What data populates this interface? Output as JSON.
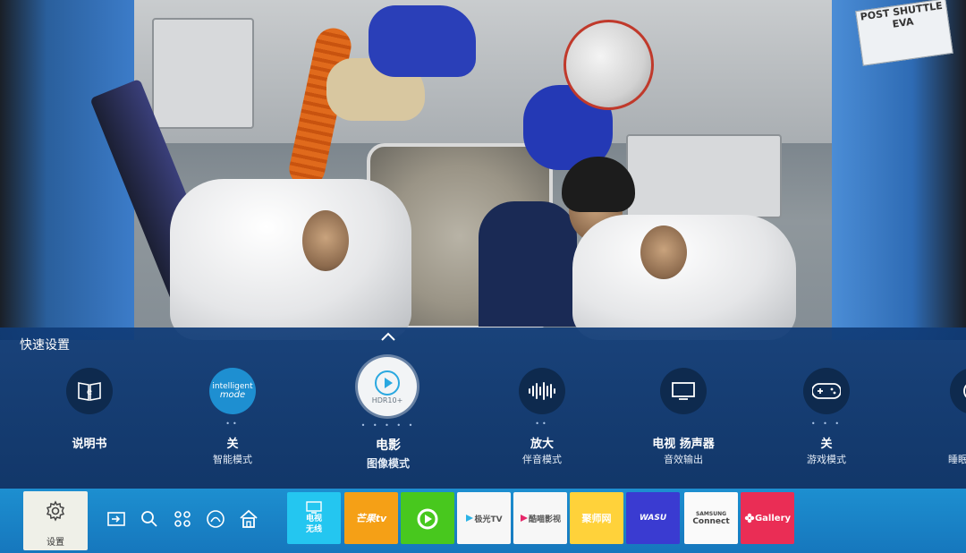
{
  "scene": {
    "sign_line1": "POST SHUTTLE",
    "sign_line2": "EVA"
  },
  "quick_settings": {
    "title": "快速设置",
    "items": [
      {
        "label": "说明书",
        "sub": "",
        "icon": "e-manual-book-icon"
      },
      {
        "label": "关",
        "sub": "智能模式",
        "icon": "intelligent-mode-icon",
        "icon_text1": "intelligent",
        "icon_text2": "mode"
      },
      {
        "label": "电影",
        "sub": "图像模式",
        "icon": "play-hdr10-icon",
        "icon_text": "HDR10+"
      },
      {
        "label": "放大",
        "sub": "伴音模式",
        "icon": "sound-wave-icon"
      },
      {
        "label": "电视 扬声器",
        "sub": "音效输出",
        "icon": "tv-speaker-icon"
      },
      {
        "label": "关",
        "sub": "游戏模式",
        "icon": "gamepad-icon"
      },
      {
        "label": "",
        "sub": "睡眠",
        "icon": "sleep-timer-icon"
      }
    ]
  },
  "bottom_bar": {
    "settings_label": "设置",
    "nav_icons": [
      "source-input-icon",
      "search-icon",
      "apps-grid-icon",
      "ambient-icon",
      "home-icon"
    ],
    "apps": [
      {
        "name": "tv",
        "line1": "电视",
        "line2": "无线"
      },
      {
        "name": "mango-tv",
        "text": "芒果tv"
      },
      {
        "name": "iqiyi-green",
        "text": ""
      },
      {
        "name": "jiguang-tv",
        "text": "极光TV"
      },
      {
        "name": "kuku-video",
        "text": "酷喵影视"
      },
      {
        "name": "juhao",
        "text": "聚师网"
      },
      {
        "name": "wasu",
        "text": "WASU"
      },
      {
        "name": "samsung-connect",
        "line1": "SAMSUNG",
        "line2": "Connect"
      },
      {
        "name": "gallery",
        "text": "Gallery"
      }
    ]
  },
  "colors": {
    "panel": "#0e3468",
    "bar": "#1d8fd0",
    "accent": "#f2f4f6"
  }
}
